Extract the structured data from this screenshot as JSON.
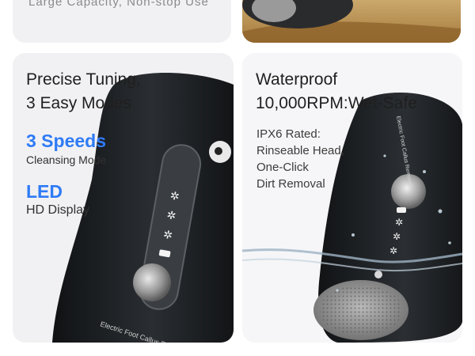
{
  "top": {
    "left_text": "Large Capacity, Non-stop Use"
  },
  "left_card": {
    "headline": [
      "Precise Tuning,",
      "3 Easy Modes"
    ],
    "feature1": {
      "title": "3 Speeds",
      "subtitle": "Cleansing Mode"
    },
    "feature2": {
      "title": "LED",
      "subtitle": "HD Display"
    },
    "device_text": "Electric Foot Callus Remover"
  },
  "right_card": {
    "headline": [
      "Waterproof",
      "10,000RPM:Wet-Safe"
    ],
    "details": [
      "IPX6 Rated:",
      "Rinseable Head,",
      "One-Click",
      "Dirt Removal"
    ],
    "device_text": "Electric Foot Callus Remover"
  },
  "colors": {
    "accent": "#2f7bf6",
    "device_body": "#1f2326",
    "card_bg": "#f1f1f3"
  }
}
